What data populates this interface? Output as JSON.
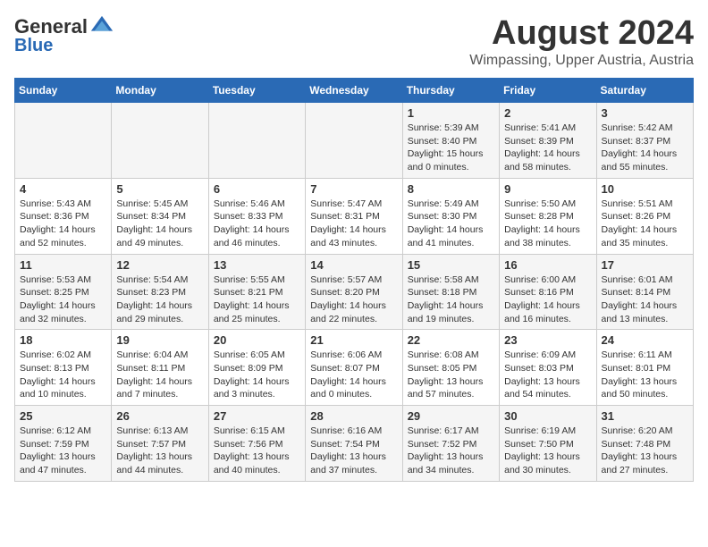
{
  "header": {
    "logo_general": "General",
    "logo_blue": "Blue",
    "main_title": "August 2024",
    "subtitle": "Wimpassing, Upper Austria, Austria"
  },
  "days_of_week": [
    "Sunday",
    "Monday",
    "Tuesday",
    "Wednesday",
    "Thursday",
    "Friday",
    "Saturday"
  ],
  "weeks": [
    [
      {
        "day": "",
        "info": ""
      },
      {
        "day": "",
        "info": ""
      },
      {
        "day": "",
        "info": ""
      },
      {
        "day": "",
        "info": ""
      },
      {
        "day": "1",
        "info": "Sunrise: 5:39 AM\nSunset: 8:40 PM\nDaylight: 15 hours\nand 0 minutes."
      },
      {
        "day": "2",
        "info": "Sunrise: 5:41 AM\nSunset: 8:39 PM\nDaylight: 14 hours\nand 58 minutes."
      },
      {
        "day": "3",
        "info": "Sunrise: 5:42 AM\nSunset: 8:37 PM\nDaylight: 14 hours\nand 55 minutes."
      }
    ],
    [
      {
        "day": "4",
        "info": "Sunrise: 5:43 AM\nSunset: 8:36 PM\nDaylight: 14 hours\nand 52 minutes."
      },
      {
        "day": "5",
        "info": "Sunrise: 5:45 AM\nSunset: 8:34 PM\nDaylight: 14 hours\nand 49 minutes."
      },
      {
        "day": "6",
        "info": "Sunrise: 5:46 AM\nSunset: 8:33 PM\nDaylight: 14 hours\nand 46 minutes."
      },
      {
        "day": "7",
        "info": "Sunrise: 5:47 AM\nSunset: 8:31 PM\nDaylight: 14 hours\nand 43 minutes."
      },
      {
        "day": "8",
        "info": "Sunrise: 5:49 AM\nSunset: 8:30 PM\nDaylight: 14 hours\nand 41 minutes."
      },
      {
        "day": "9",
        "info": "Sunrise: 5:50 AM\nSunset: 8:28 PM\nDaylight: 14 hours\nand 38 minutes."
      },
      {
        "day": "10",
        "info": "Sunrise: 5:51 AM\nSunset: 8:26 PM\nDaylight: 14 hours\nand 35 minutes."
      }
    ],
    [
      {
        "day": "11",
        "info": "Sunrise: 5:53 AM\nSunset: 8:25 PM\nDaylight: 14 hours\nand 32 minutes."
      },
      {
        "day": "12",
        "info": "Sunrise: 5:54 AM\nSunset: 8:23 PM\nDaylight: 14 hours\nand 29 minutes."
      },
      {
        "day": "13",
        "info": "Sunrise: 5:55 AM\nSunset: 8:21 PM\nDaylight: 14 hours\nand 25 minutes."
      },
      {
        "day": "14",
        "info": "Sunrise: 5:57 AM\nSunset: 8:20 PM\nDaylight: 14 hours\nand 22 minutes."
      },
      {
        "day": "15",
        "info": "Sunrise: 5:58 AM\nSunset: 8:18 PM\nDaylight: 14 hours\nand 19 minutes."
      },
      {
        "day": "16",
        "info": "Sunrise: 6:00 AM\nSunset: 8:16 PM\nDaylight: 14 hours\nand 16 minutes."
      },
      {
        "day": "17",
        "info": "Sunrise: 6:01 AM\nSunset: 8:14 PM\nDaylight: 14 hours\nand 13 minutes."
      }
    ],
    [
      {
        "day": "18",
        "info": "Sunrise: 6:02 AM\nSunset: 8:13 PM\nDaylight: 14 hours\nand 10 minutes."
      },
      {
        "day": "19",
        "info": "Sunrise: 6:04 AM\nSunset: 8:11 PM\nDaylight: 14 hours\nand 7 minutes."
      },
      {
        "day": "20",
        "info": "Sunrise: 6:05 AM\nSunset: 8:09 PM\nDaylight: 14 hours\nand 3 minutes."
      },
      {
        "day": "21",
        "info": "Sunrise: 6:06 AM\nSunset: 8:07 PM\nDaylight: 14 hours\nand 0 minutes."
      },
      {
        "day": "22",
        "info": "Sunrise: 6:08 AM\nSunset: 8:05 PM\nDaylight: 13 hours\nand 57 minutes."
      },
      {
        "day": "23",
        "info": "Sunrise: 6:09 AM\nSunset: 8:03 PM\nDaylight: 13 hours\nand 54 minutes."
      },
      {
        "day": "24",
        "info": "Sunrise: 6:11 AM\nSunset: 8:01 PM\nDaylight: 13 hours\nand 50 minutes."
      }
    ],
    [
      {
        "day": "25",
        "info": "Sunrise: 6:12 AM\nSunset: 7:59 PM\nDaylight: 13 hours\nand 47 minutes."
      },
      {
        "day": "26",
        "info": "Sunrise: 6:13 AM\nSunset: 7:57 PM\nDaylight: 13 hours\nand 44 minutes."
      },
      {
        "day": "27",
        "info": "Sunrise: 6:15 AM\nSunset: 7:56 PM\nDaylight: 13 hours\nand 40 minutes."
      },
      {
        "day": "28",
        "info": "Sunrise: 6:16 AM\nSunset: 7:54 PM\nDaylight: 13 hours\nand 37 minutes."
      },
      {
        "day": "29",
        "info": "Sunrise: 6:17 AM\nSunset: 7:52 PM\nDaylight: 13 hours\nand 34 minutes."
      },
      {
        "day": "30",
        "info": "Sunrise: 6:19 AM\nSunset: 7:50 PM\nDaylight: 13 hours\nand 30 minutes."
      },
      {
        "day": "31",
        "info": "Sunrise: 6:20 AM\nSunset: 7:48 PM\nDaylight: 13 hours\nand 27 minutes."
      }
    ]
  ]
}
